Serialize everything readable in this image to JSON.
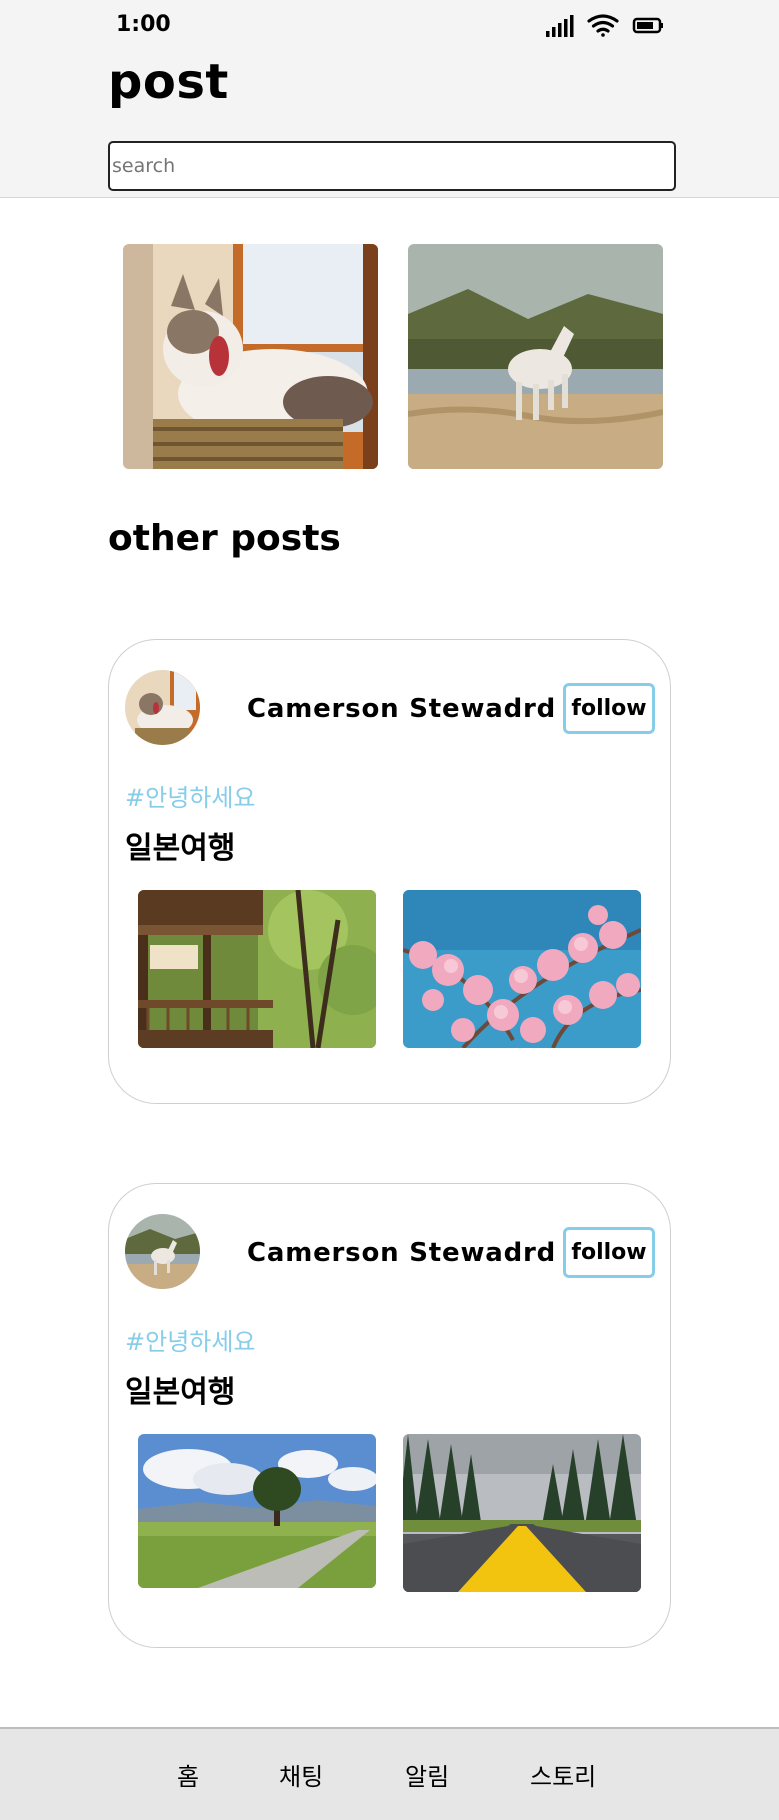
{
  "status_bar": {
    "time": "1:00",
    "icons": [
      "cellular-signal-icon",
      "wifi-icon",
      "battery-icon"
    ]
  },
  "header": {
    "title": "post",
    "search_placeholder": "search"
  },
  "featured": {
    "images": [
      "cat-photo",
      "horse-photo"
    ]
  },
  "other_posts": {
    "title": "other posts",
    "posts": [
      {
        "avatar": "cat-avatar",
        "author": "Camerson Stewadrd",
        "follow_label": "follow",
        "hashtag": "#안녕하세요",
        "title": "일본여행",
        "images": [
          "temple-photo",
          "cherry-blossom-photo"
        ]
      },
      {
        "avatar": "horse-avatar",
        "author": "Camerson Stewadrd",
        "follow_label": "follow",
        "hashtag": "#안녕하세요",
        "title": "일본여행",
        "images": [
          "meadow-tree-photo",
          "road-forest-photo"
        ]
      }
    ]
  },
  "bottom_nav": {
    "items": [
      "홈",
      "채팅",
      "알림",
      "스토리"
    ]
  },
  "colors": {
    "accent": "#87cdea",
    "header_bg": "#f4f4f4",
    "nav_bg": "#e6e6e6"
  }
}
